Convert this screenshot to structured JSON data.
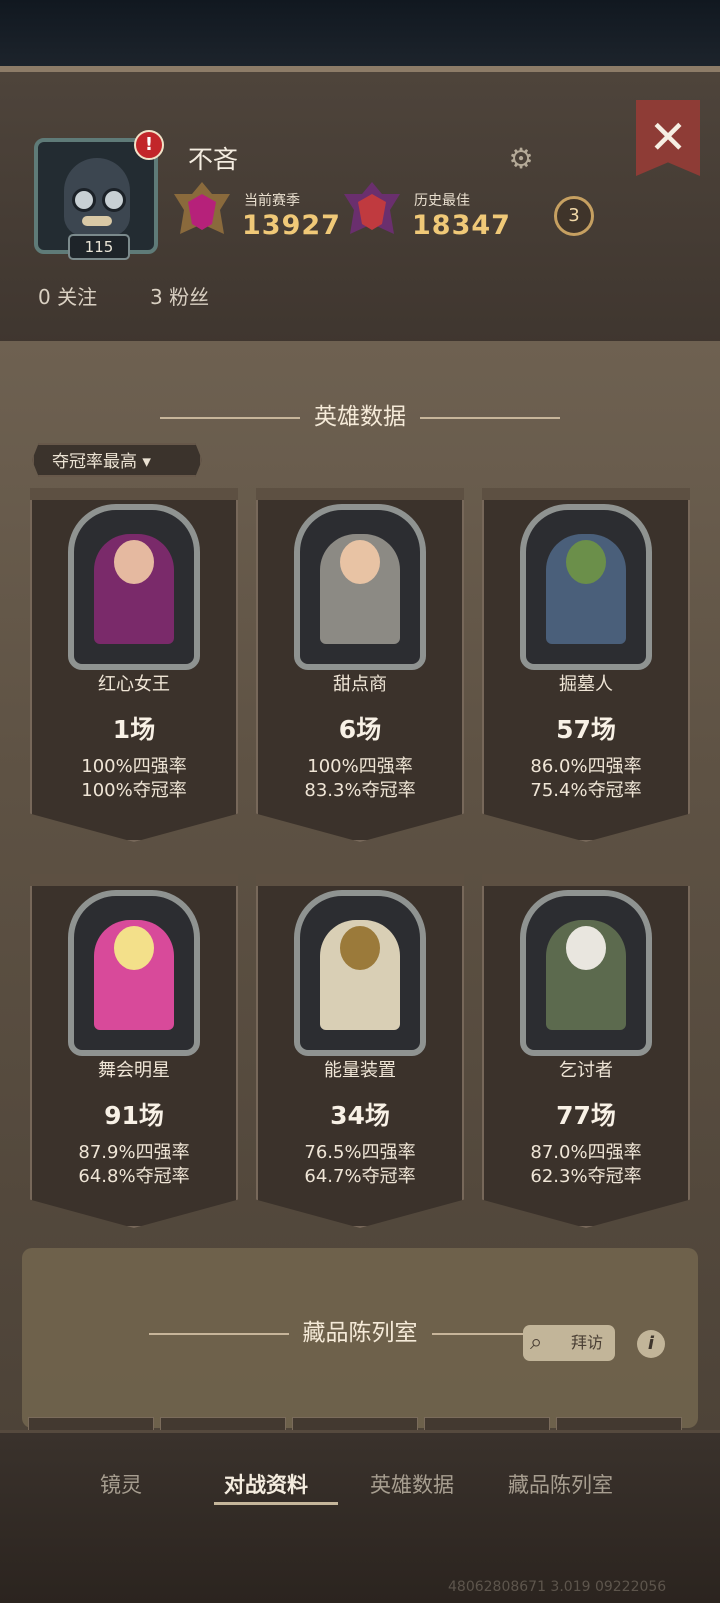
{
  "profile": {
    "name": "不吝",
    "level": "115",
    "alert": "!",
    "season_label": "当前赛季",
    "season_value": "13927",
    "best_label": "历史最佳",
    "best_value": "18347",
    "crown_count": "3",
    "following": "0 关注",
    "fans": "3 粉丝"
  },
  "hero_section": {
    "title": "英雄数据",
    "filter_label": "夺冠率最高"
  },
  "heroes": [
    {
      "name": "红心女王",
      "games": "1场",
      "top4": "100%四强率",
      "win": "100%夺冠率"
    },
    {
      "name": "甜点商",
      "games": "6场",
      "top4": "100%四强率",
      "win": "83.3%夺冠率"
    },
    {
      "name": "掘墓人",
      "games": "57场",
      "top4": "86.0%四强率",
      "win": "75.4%夺冠率"
    },
    {
      "name": "舞会明星",
      "games": "91场",
      "top4": "87.9%四强率",
      "win": "64.8%夺冠率"
    },
    {
      "name": "能量装置",
      "games": "34场",
      "top4": "76.5%四强率",
      "win": "64.7%夺冠率"
    },
    {
      "name": "乞讨者",
      "games": "77场",
      "top4": "87.0%四强率",
      "win": "62.3%夺冠率"
    }
  ],
  "collection": {
    "title": "藏品陈列室",
    "visit_label": "拜访",
    "info": "i"
  },
  "tabs": [
    "镜灵",
    "对战资料",
    "英雄数据",
    "藏品陈列室"
  ],
  "footer_id": "48062808671 3.019 09222056",
  "icons": {
    "close": "close-icon",
    "settings": "gear-icon"
  },
  "colors": {
    "accent_gold": "#f0c978",
    "close_red": "#8e3c36"
  }
}
